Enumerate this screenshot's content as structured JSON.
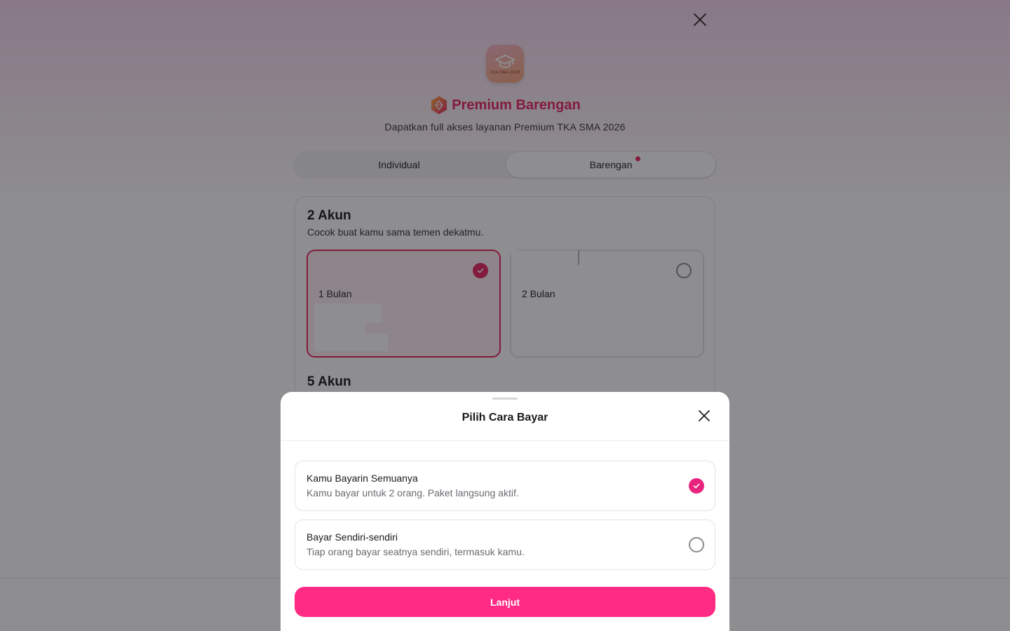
{
  "header": {
    "close_icon": "close-icon",
    "logo_caption": "TKA SMA 2026",
    "title": "Premium Barengan",
    "title_icon": "premium-hexagon-icon",
    "subtitle": "Dapatkan full akses layanan Premium TKA SMA 2026"
  },
  "tabs": [
    {
      "label": "Individual",
      "active": false
    },
    {
      "label": "Barengan",
      "active": true,
      "has_dot": true
    }
  ],
  "packages": [
    {
      "title": "2 Akun",
      "description": "Cocok buat kamu sama temen dekatmu.",
      "options": [
        {
          "label": "1 Bulan",
          "selected": true
        },
        {
          "label": "2 Bulan",
          "selected": false
        }
      ]
    },
    {
      "title": "5 Akun"
    }
  ],
  "sheet": {
    "title": "Pilih Cara Bayar",
    "options": [
      {
        "title": "Kamu Bayarin Semuanya",
        "description": "Kamu bayar untuk 2 orang. Paket langsung aktif.",
        "selected": true
      },
      {
        "title": "Bayar Sendiri-sendiri",
        "description": "Tiap orang bayar seatnya sendiri, termasuk kamu.",
        "selected": false
      }
    ],
    "cta_label": "Lanjut"
  },
  "colors": {
    "brand": "#e8245f",
    "cta": "#ff2b84",
    "radio_selected": "#e8247f"
  }
}
